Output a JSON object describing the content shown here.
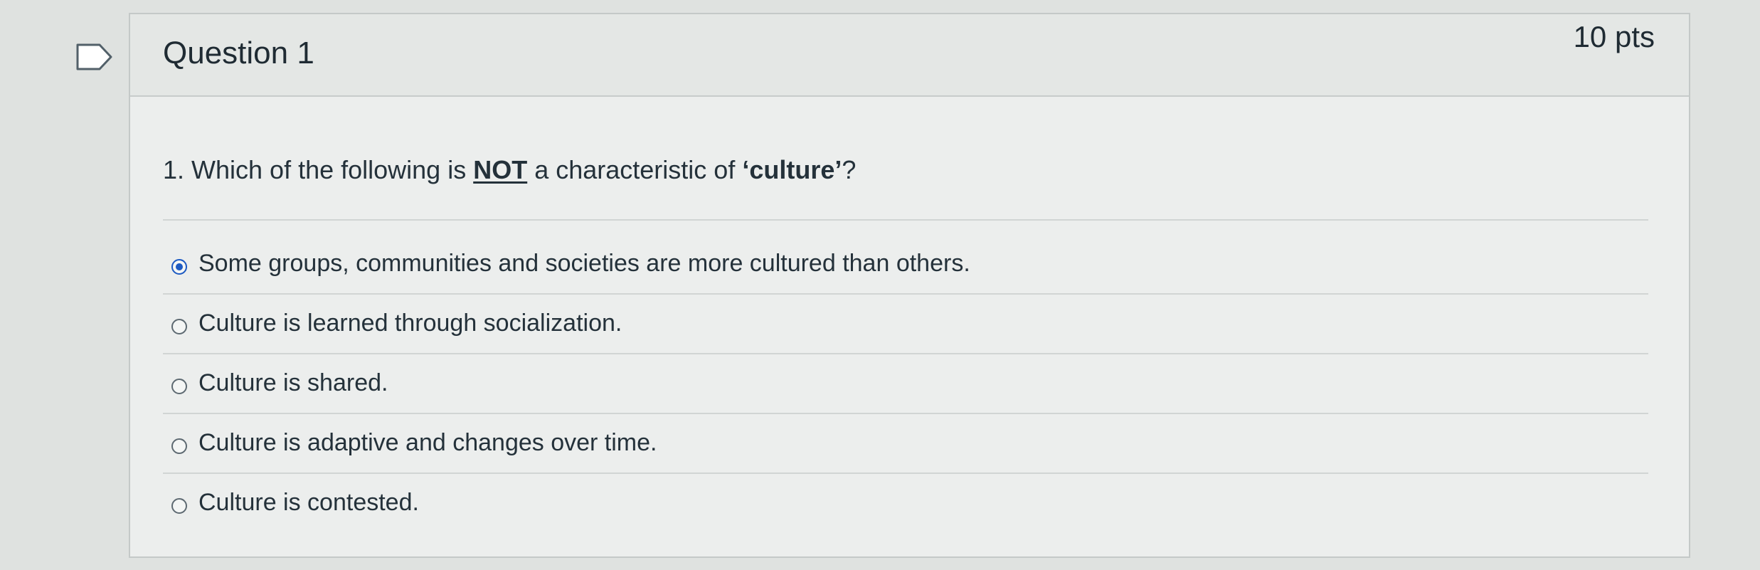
{
  "question": {
    "title": "Question 1",
    "points": "10 pts",
    "prompt_prefix": "1. Which of the following is ",
    "prompt_emphasis": "NOT",
    "prompt_middle": " a characteristic of ",
    "prompt_term": "‘culture’",
    "prompt_suffix": "?",
    "answers": [
      {
        "label": "Some groups, communities and societies are more cultured than others.",
        "selected": true
      },
      {
        "label": "Culture is learned through socialization.",
        "selected": false
      },
      {
        "label": "Culture is shared.",
        "selected": false
      },
      {
        "label": "Culture is adaptive and changes over time.",
        "selected": false
      },
      {
        "label": "Culture is contested.",
        "selected": false
      }
    ]
  },
  "colors": {
    "accent": "#1d5ac2",
    "text": "#24313a",
    "border": "#c4c9c8"
  },
  "icons": {
    "flag": "flag-icon"
  }
}
